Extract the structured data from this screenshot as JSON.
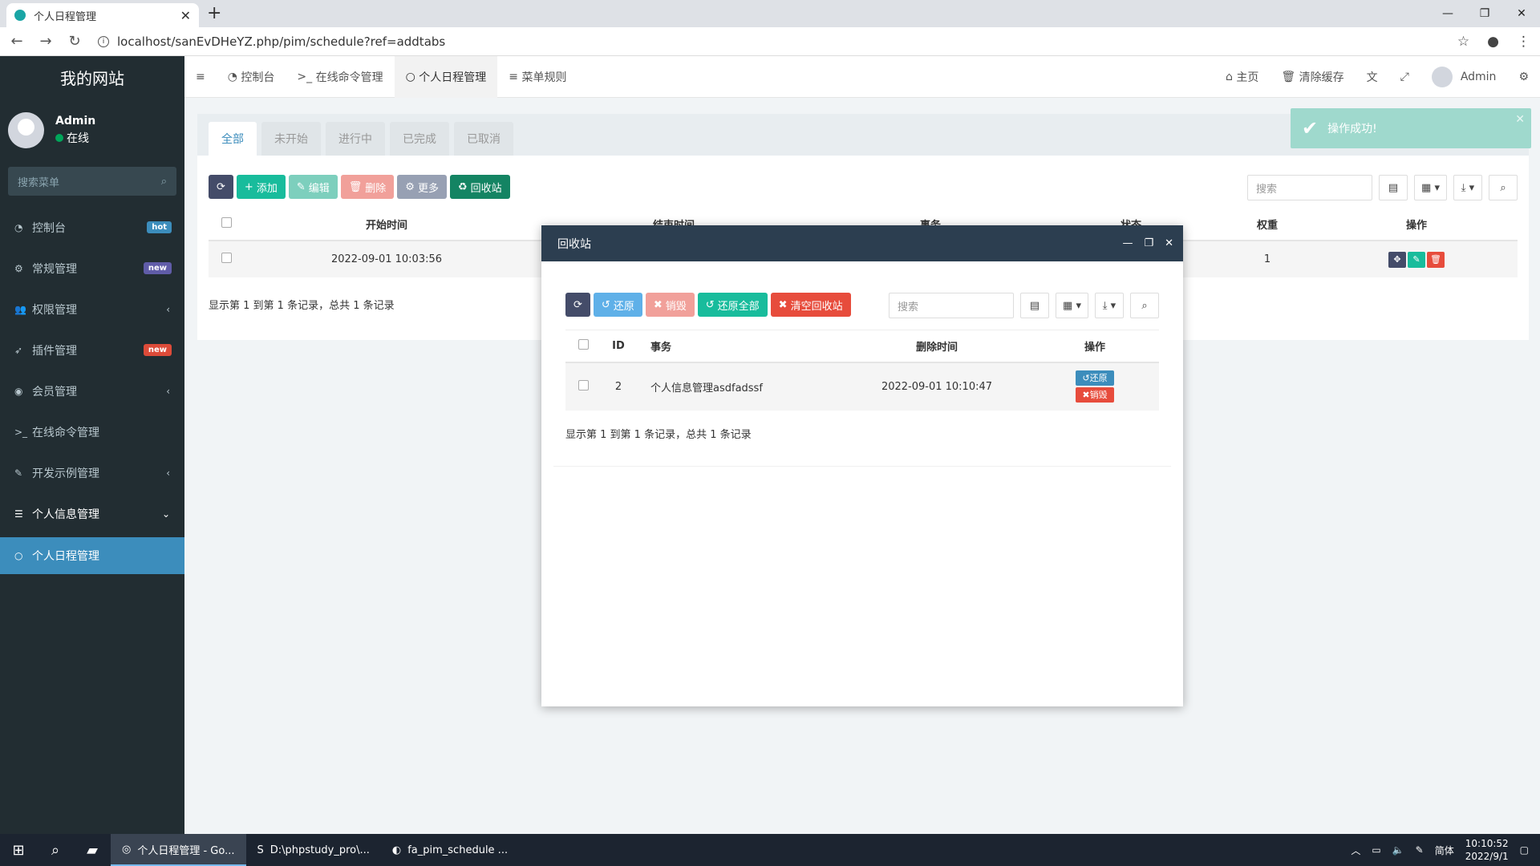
{
  "browser": {
    "tab_title": "个人日程管理",
    "url": "localhost/sanEvDHeYZ.php/pim/schedule?ref=addtabs"
  },
  "sidebar": {
    "site_name": "我的网站",
    "user_name": "Admin",
    "status": "在线",
    "search_placeholder": "搜索菜单",
    "items": [
      {
        "label": "控制台",
        "icon": "dashboard-icon",
        "badge": "hot",
        "badge_color": "#3c8dbc"
      },
      {
        "label": "常规管理",
        "icon": "cogs-icon",
        "badge": "new",
        "badge_color": "#605ca8"
      },
      {
        "label": "权限管理",
        "icon": "group-icon"
      },
      {
        "label": "插件管理",
        "icon": "rocket-icon",
        "badge": "new",
        "badge_color": "#dd4b39"
      },
      {
        "label": "会员管理",
        "icon": "user-circle-icon"
      },
      {
        "label": "在线命令管理",
        "icon": "terminal-icon"
      },
      {
        "label": "开发示例管理",
        "icon": "magic-icon"
      },
      {
        "label": "个人信息管理",
        "icon": "list-icon"
      },
      {
        "label": "个人日程管理",
        "icon": "circle-icon"
      }
    ]
  },
  "header": {
    "tabs": [
      "控制台",
      "在线命令管理",
      "个人日程管理",
      "菜单规则"
    ],
    "home": "主页",
    "clear_cache": "清除缓存",
    "admin": "Admin"
  },
  "toast": {
    "message": "操作成功!"
  },
  "page": {
    "filter_tabs": [
      "全部",
      "未开始",
      "进行中",
      "已完成",
      "已取消"
    ],
    "buttons": {
      "add": "添加",
      "edit": "编辑",
      "delete": "删除",
      "more": "更多",
      "recycle": "回收站"
    },
    "search_placeholder": "搜索",
    "columns": {
      "start": "开始时间",
      "end": "结束时间",
      "task": "事务",
      "status": "状态",
      "weight": "权重",
      "ops": "操作"
    },
    "rows": [
      {
        "start": "2022-09-01 10:03:56",
        "weight": "1"
      }
    ],
    "pagination": "显示第 1 到第 1 条记录，总共 1 条记录"
  },
  "modal": {
    "title": "回收站",
    "buttons": {
      "restore": "还原",
      "destroy": "销毁",
      "restore_all": "还原全部",
      "clear": "清空回收站"
    },
    "search_placeholder": "搜索",
    "columns": {
      "id": "ID",
      "task": "事务",
      "deleted_at": "删除时间",
      "ops": "操作"
    },
    "rows": [
      {
        "id": "2",
        "task": "个人信息管理asdfadssf",
        "deleted_at": "2022-09-01 10:10:47",
        "restore": "还原",
        "destroy": "销毁"
      }
    ],
    "pagination": "显示第 1 到第 1 条记录，总共 1 条记录"
  },
  "taskbar": {
    "items": [
      "个人日程管理 - Go...",
      "D:\\phpstudy_pro\\...",
      "fa_pim_schedule ..."
    ],
    "ime": "简体",
    "time": "10:10:52",
    "date": "2022/9/1"
  }
}
